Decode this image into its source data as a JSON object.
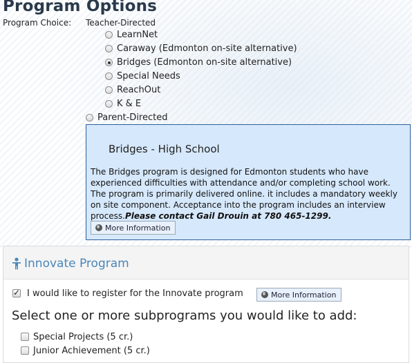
{
  "page_title": "Program Options",
  "program_choice": {
    "label": "Program Choice:",
    "teacher_directed_label": "Teacher-Directed",
    "options": [
      {
        "label": "LearnNet",
        "checked": false
      },
      {
        "label": "Caraway (Edmonton on-site alternative)",
        "checked": false
      },
      {
        "label": "Bridges (Edmonton on-site alternative)",
        "checked": true
      },
      {
        "label": "Special Needs",
        "checked": false
      },
      {
        "label": "ReachOut",
        "checked": false
      },
      {
        "label": "K & E",
        "checked": false
      }
    ],
    "parent_directed_label": "Parent-Directed"
  },
  "info_box": {
    "title": "Bridges - High School",
    "description": "The Bridges program is designed for Edmonton students who have experienced difficulties with attendance and/or completing school work. The program is primarily delivered online. it includes a mandatory weekly on site component. Acceptance into the program includes an interview process.",
    "contact": "Please contact Gail Drouin at 780 465-1299.",
    "more_info_label": "More Information",
    "background_color": "#d6e8fb",
    "border_color": "#2b5e9c"
  },
  "innovate": {
    "title": "Innovate Program",
    "icon": "person-icon",
    "register_label": "I would like to register for the Innovate program",
    "register_checked": true,
    "more_info_label": "More Information",
    "subprograms_heading": "Select one or more subprograms you would like to add:",
    "subprograms": [
      {
        "label": "Special Projects (5 cr.)",
        "checked": false
      },
      {
        "label": "Junior Achievement (5 cr.)",
        "checked": false
      }
    ],
    "accent_color": "#4a86b8"
  }
}
